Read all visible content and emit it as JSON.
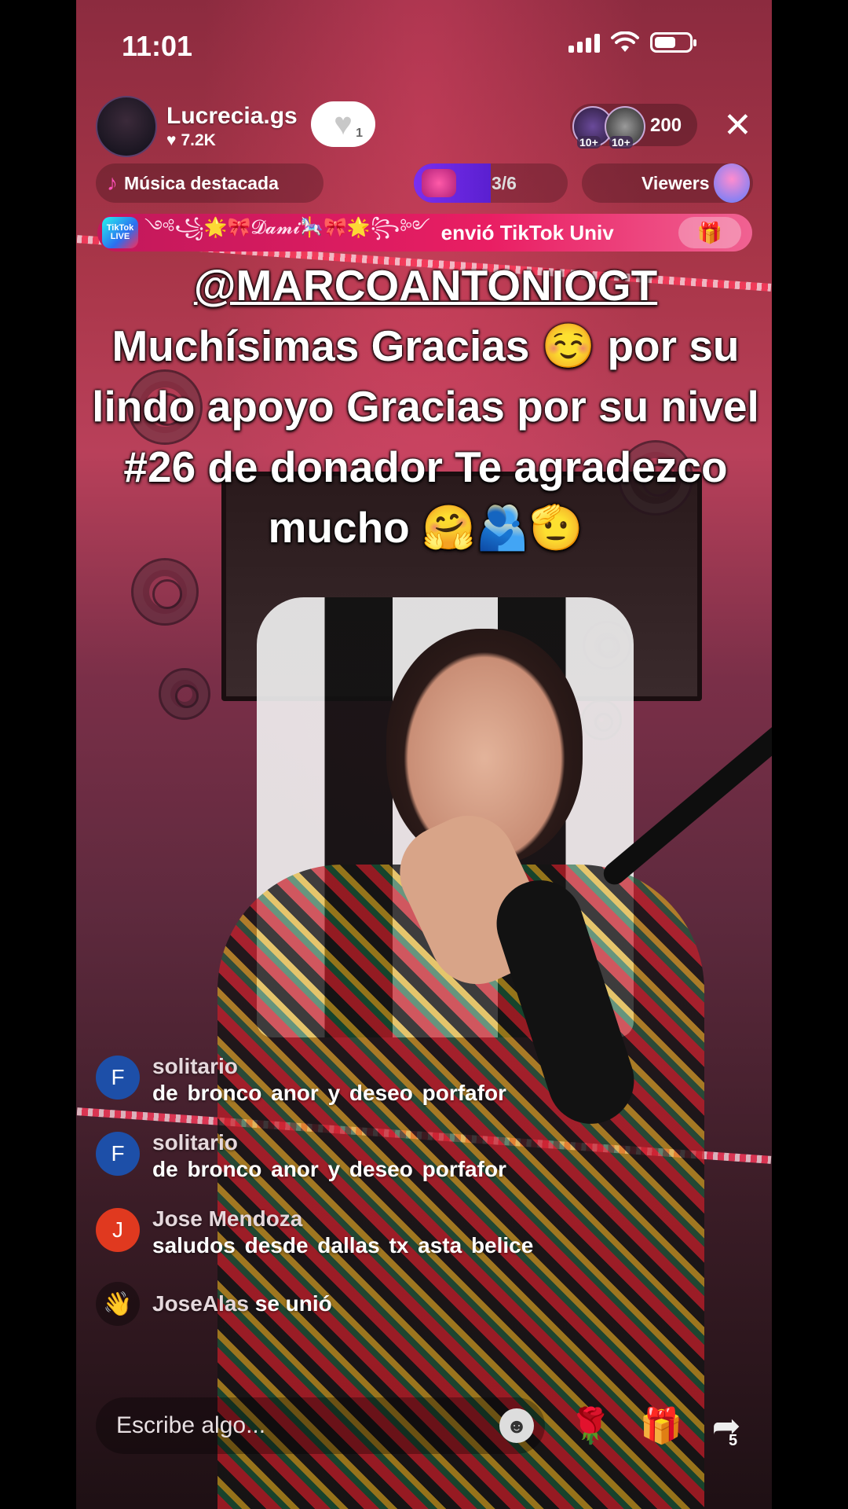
{
  "status_bar": {
    "time": "11:01"
  },
  "host": {
    "name": "Lucrecia.gs",
    "likes": "7.2K",
    "follow_count": "1"
  },
  "viewers": {
    "count": "200",
    "badge_1": "10+",
    "badge_2": "10+"
  },
  "top_pills": {
    "music_label": "Música destacada",
    "goal_progress_label": "3/6",
    "goal_progress_fraction": 0.5,
    "viewers_label": "Viewers"
  },
  "gift_banner": {
    "badge_text": "TikTok LIVE",
    "decoration": "༺꧁🌟🎀𝓓𝓪𝓶𝓲🎠🎀🌟꧂༻",
    "text": "envió TikTok Univ"
  },
  "caption": {
    "mention": "@MARCOANTONIOGT",
    "message": "Muchísimas Gracias ☺️ por su lindo apoyo Gracias por su nivel #26 de donador Te agradezco mucho 🤗🫂🫡"
  },
  "comments": [
    {
      "initial": "F",
      "avatar_color": "#1d4fa8",
      "user": "solitario",
      "text": "de  bronco   anor  y deseo  porfafor"
    },
    {
      "initial": "F",
      "avatar_color": "#1d4fa8",
      "user": "solitario",
      "text": "de  bronco   anor  y deseo  porfafor"
    },
    {
      "initial": "J",
      "avatar_color": "#e0391f",
      "user": "Jose Mendoza",
      "text": "saludos desde dallas tx asta belice"
    }
  ],
  "join_event": {
    "user": "JoseAlas",
    "action": " se unió"
  },
  "input": {
    "placeholder": "Escribe algo..."
  },
  "actions": {
    "share_count": "5"
  },
  "colors": {
    "banner": "#e91e63",
    "goal_fill": "#7a2ff0",
    "accent_pink": "#ff4fb8"
  },
  "icons": [
    "wifi-icon",
    "battery-icon",
    "heart-icon",
    "close-icon",
    "music-note-icon",
    "gift-icon",
    "emoji-icon",
    "rose-icon",
    "share-icon",
    "wave-icon"
  ]
}
